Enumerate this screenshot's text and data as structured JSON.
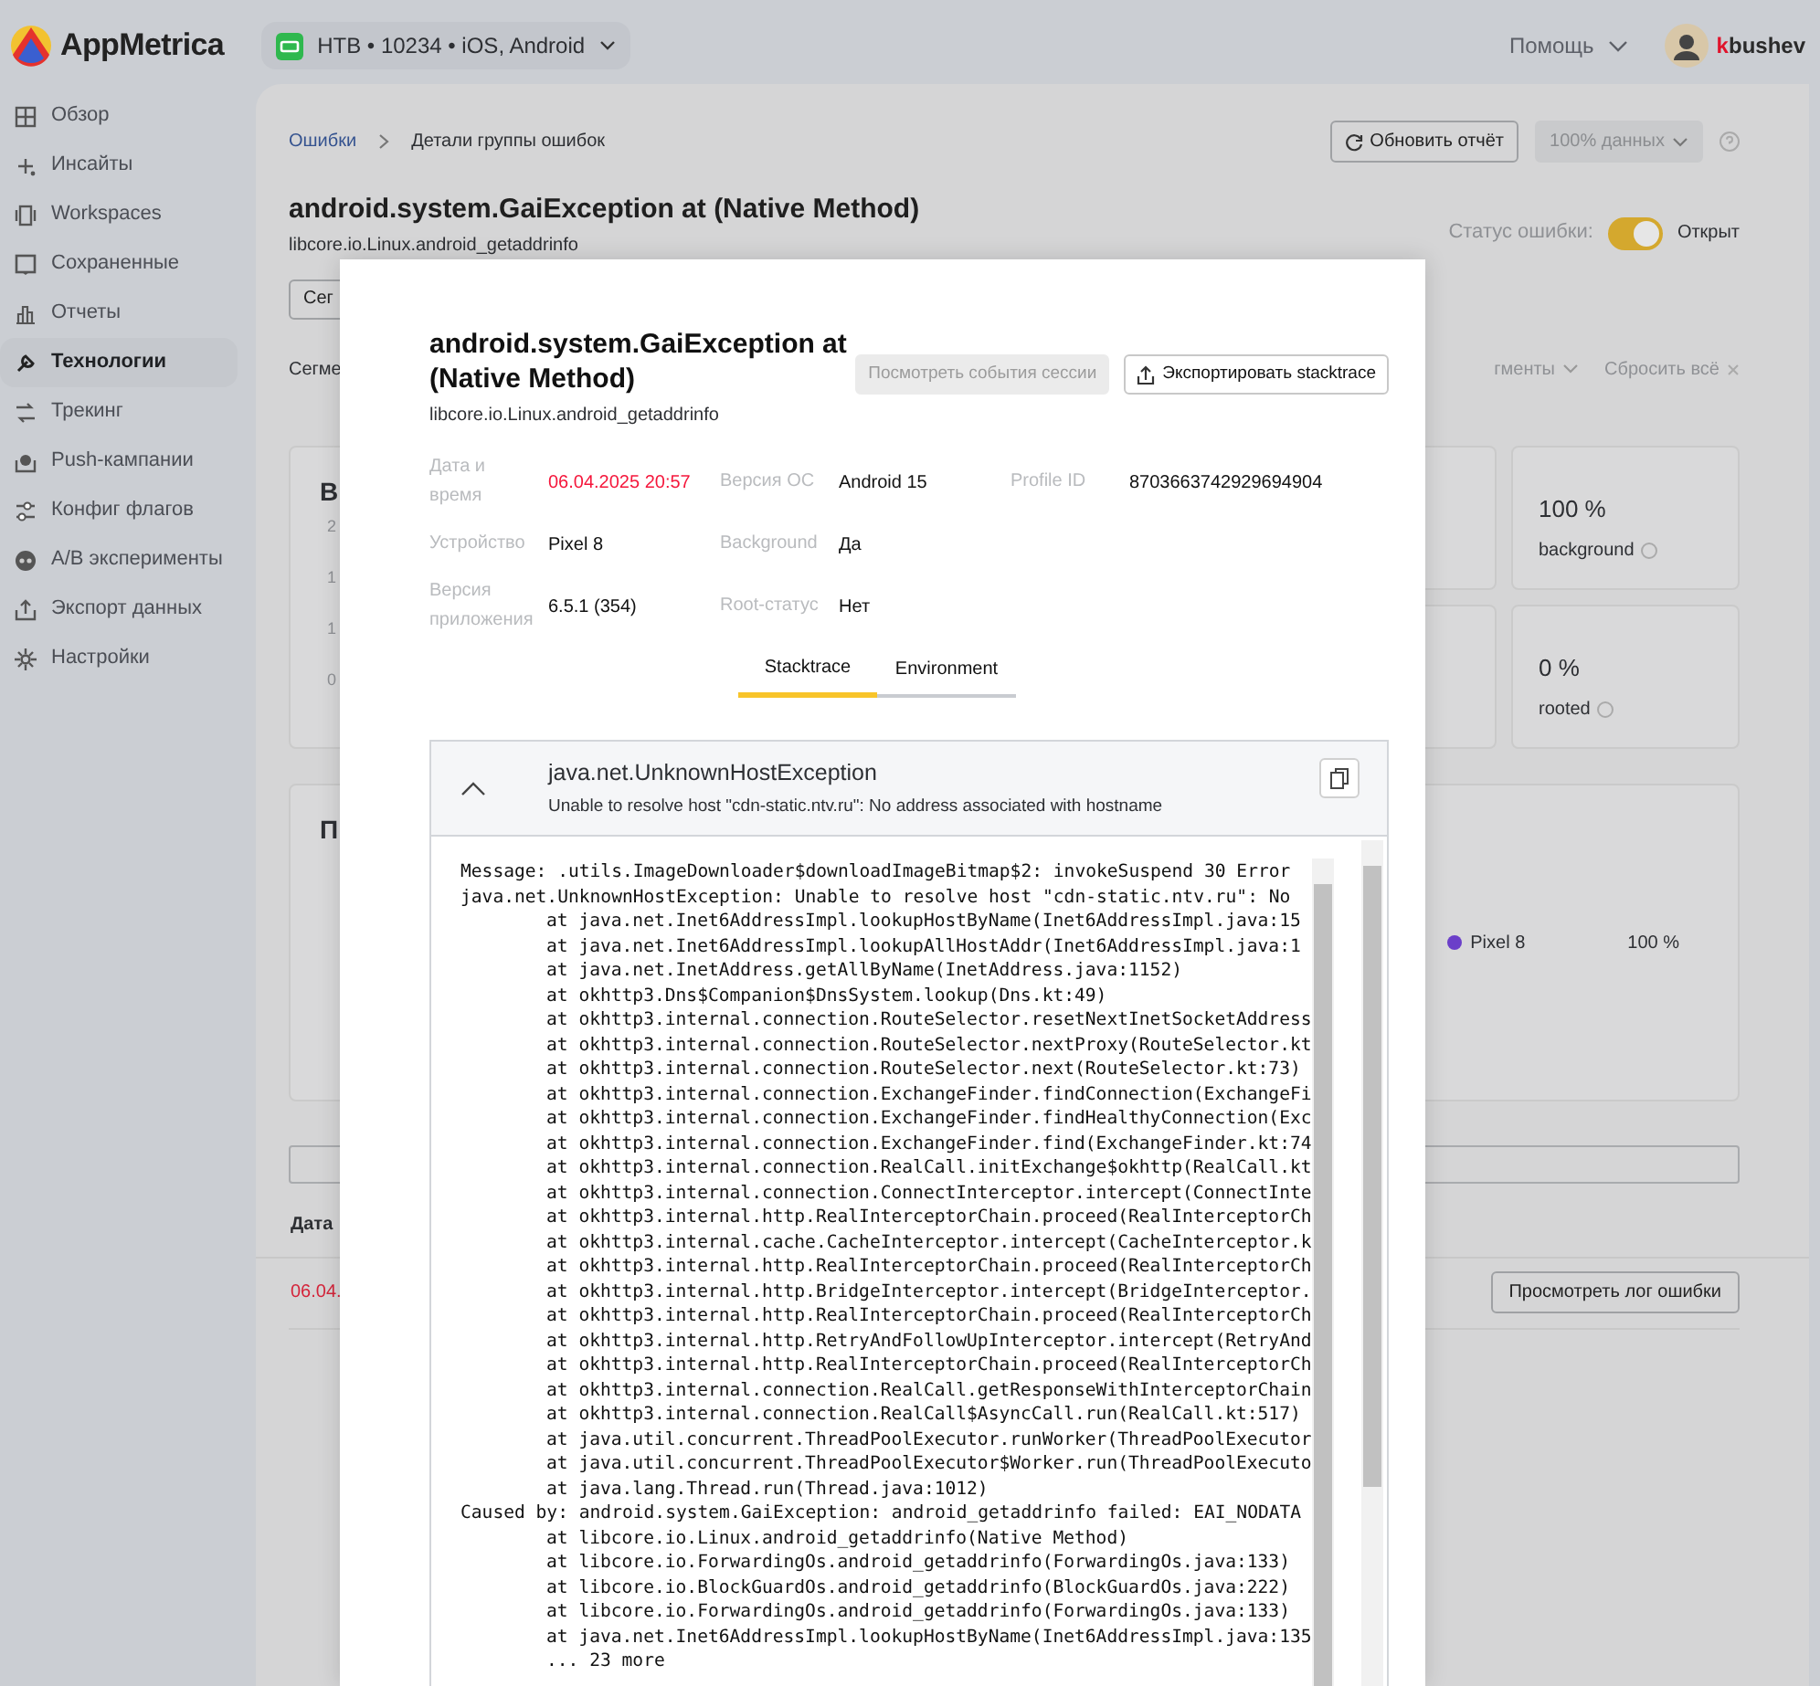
{
  "topbar": {
    "logo": "AppMetrica",
    "project": "НТВ • 10234 • iOS, Android",
    "help": "Помощь",
    "user": "kbushev"
  },
  "sidebar": {
    "items": [
      {
        "label": "Обзор",
        "selected": false
      },
      {
        "label": "Инсайты",
        "selected": false
      },
      {
        "label": "Workspaces",
        "selected": false
      },
      {
        "label": "Сохраненные",
        "selected": false
      },
      {
        "label": "Отчеты",
        "selected": false
      },
      {
        "label": "Технологии",
        "selected": true
      },
      {
        "label": "Трекинг",
        "selected": false
      },
      {
        "label": "Push-кампании",
        "selected": false
      },
      {
        "label": "Конфиг флагов",
        "selected": false
      },
      {
        "label": "A/B эксперименты",
        "selected": false
      },
      {
        "label": "Экспорт данных",
        "selected": false
      },
      {
        "label": "Настройки",
        "selected": false
      }
    ]
  },
  "breadcrumbs": [
    {
      "label": "Ошибки",
      "kind": "link"
    },
    {
      "label": "Детали группы ошибок",
      "kind": "current"
    }
  ],
  "toolbar": {
    "refresh": "Обновить отчёт",
    "sampling": "100% данных"
  },
  "header": {
    "title": "android.system.GaiException at (Native Method)",
    "subtitle": "libcore.io.Linux.android_getaddrinfo",
    "status_label": "Статус ошибки:",
    "status_on": true,
    "status_value": "Открыт"
  },
  "filters": {
    "segment_button": "Сег",
    "segment_label": "Сегме",
    "segments_dropdown": "гменты",
    "reset": "Сбросить всё"
  },
  "chart_card": {
    "title": "В",
    "axis_labels": [
      "2",
      "1",
      "1",
      "0"
    ]
  },
  "stats": [
    {
      "value": "100 %",
      "label": "background"
    },
    {
      "value": "0 %",
      "label": "rooted"
    }
  ],
  "device_card": {
    "title": "П",
    "legend": [
      {
        "label": "Pixel 8",
        "value": "100 %",
        "color": "#6b3fc9"
      }
    ]
  },
  "table": {
    "columns": [
      "Дата"
    ],
    "rows": [
      {
        "date": "06.04.",
        "action": "Просмотреть лог ошибки"
      }
    ]
  },
  "modal": {
    "title": "android.system.GaiException at (Native Method)",
    "subtitle": "libcore.io.Linux.android_getaddrinfo",
    "session_button": {
      "label": "Посмотреть события сессии",
      "disabled": true
    },
    "export_button": "Экспортировать stacktrace",
    "field_rows": [
      [
        {
          "label": "Дата и время",
          "value": "06.04.2025 20:57",
          "kind": "timestamp"
        },
        {
          "label": "Версия ОС",
          "value": "Android 15",
          "kind": "plain"
        },
        {
          "label": "Profile ID",
          "value": "8703663742929694904",
          "kind": "plain"
        }
      ],
      [
        {
          "label": "Устройство",
          "value": "Pixel 8",
          "kind": "plain"
        },
        {
          "label": "Background",
          "value": "Да",
          "kind": "plain"
        }
      ],
      [
        {
          "label": "Версия приложения",
          "value": "6.5.1 (354)",
          "kind": "plain"
        },
        {
          "label": "Root-статус",
          "value": "Нет",
          "kind": "plain"
        }
      ]
    ],
    "tabs": [
      {
        "label": "Stacktrace",
        "selected": true
      },
      {
        "label": "Environment",
        "selected": false
      }
    ],
    "exception": {
      "name": "java.net.UnknownHostException",
      "message": "Unable to resolve host \"cdn-static.ntv.ru\": No address associated with hostname",
      "expanded": true
    },
    "stack_lines": [
      {
        "kind": "head",
        "text": "Message: .utils.ImageDownloader$downloadImageBitmap$2: invokeSuspend 30 Error"
      },
      {
        "kind": "head",
        "text": "java.net.UnknownHostException: Unable to resolve host \"cdn-static.ntv.ru\": No"
      },
      {
        "kind": "frame",
        "text": "at java.net.Inet6AddressImpl.lookupHostByName(Inet6AddressImpl.java:15"
      },
      {
        "kind": "frame",
        "text": "at java.net.Inet6AddressImpl.lookupAllHostAddr(Inet6AddressImpl.java:1"
      },
      {
        "kind": "frame",
        "text": "at java.net.InetAddress.getAllByName(InetAddress.java:1152)"
      },
      {
        "kind": "frame",
        "text": "at okhttp3.Dns$Companion$DnsSystem.lookup(Dns.kt:49)"
      },
      {
        "kind": "frame",
        "text": "at okhttp3.internal.connection.RouteSelector.resetNextInetSocketAddress"
      },
      {
        "kind": "frame",
        "text": "at okhttp3.internal.connection.RouteSelector.nextProxy(RouteSelector.kt"
      },
      {
        "kind": "frame",
        "text": "at okhttp3.internal.connection.RouteSelector.next(RouteSelector.kt:73)"
      },
      {
        "kind": "frame",
        "text": "at okhttp3.internal.connection.ExchangeFinder.findConnection(ExchangeFi"
      },
      {
        "kind": "frame",
        "text": "at okhttp3.internal.connection.ExchangeFinder.findHealthyConnection(Exc"
      },
      {
        "kind": "frame",
        "text": "at okhttp3.internal.connection.ExchangeFinder.find(ExchangeFinder.kt:74"
      },
      {
        "kind": "frame",
        "text": "at okhttp3.internal.connection.RealCall.initExchange$okhttp(RealCall.kt"
      },
      {
        "kind": "frame",
        "text": "at okhttp3.internal.connection.ConnectInterceptor.intercept(ConnectInte"
      },
      {
        "kind": "frame",
        "text": "at okhttp3.internal.http.RealInterceptorChain.proceed(RealInterceptorCh"
      },
      {
        "kind": "frame",
        "text": "at okhttp3.internal.cache.CacheInterceptor.intercept(CacheInterceptor.k"
      },
      {
        "kind": "frame",
        "text": "at okhttp3.internal.http.RealInterceptorChain.proceed(RealInterceptorCh"
      },
      {
        "kind": "frame",
        "text": "at okhttp3.internal.http.BridgeInterceptor.intercept(BridgeInterceptor."
      },
      {
        "kind": "frame",
        "text": "at okhttp3.internal.http.RealInterceptorChain.proceed(RealInterceptorCh"
      },
      {
        "kind": "frame",
        "text": "at okhttp3.internal.http.RetryAndFollowUpInterceptor.intercept(RetryAnd"
      },
      {
        "kind": "frame",
        "text": "at okhttp3.internal.http.RealInterceptorChain.proceed(RealInterceptorCh"
      },
      {
        "kind": "frame",
        "text": "at okhttp3.internal.connection.RealCall.getResponseWithInterceptorChain"
      },
      {
        "kind": "frame",
        "text": "at okhttp3.internal.connection.RealCall$AsyncCall.run(RealCall.kt:517)"
      },
      {
        "kind": "frame",
        "text": "at java.util.concurrent.ThreadPoolExecutor.runWorker(ThreadPoolExecutor"
      },
      {
        "kind": "frame",
        "text": "at java.util.concurrent.ThreadPoolExecutor$Worker.run(ThreadPoolExecuto"
      },
      {
        "kind": "frame",
        "text": "at java.lang.Thread.run(Thread.java:1012)"
      },
      {
        "kind": "head",
        "text": "Caused by: android.system.GaiException: android_getaddrinfo failed: EAI_NODATA"
      },
      {
        "kind": "frame",
        "text": "at libcore.io.Linux.android_getaddrinfo(Native Method)"
      },
      {
        "kind": "frame",
        "text": "at libcore.io.ForwardingOs.android_getaddrinfo(ForwardingOs.java:133)"
      },
      {
        "kind": "frame",
        "text": "at libcore.io.BlockGuardOs.android_getaddrinfo(BlockGuardOs.java:222)"
      },
      {
        "kind": "frame",
        "text": "at libcore.io.ForwardingOs.android_getaddrinfo(ForwardingOs.java:133)"
      },
      {
        "kind": "frame",
        "text": "at java.net.Inet6AddressImpl.lookupHostByName(Inet6AddressImpl.java:135"
      },
      {
        "kind": "frame",
        "text": "... 23 more"
      }
    ]
  }
}
